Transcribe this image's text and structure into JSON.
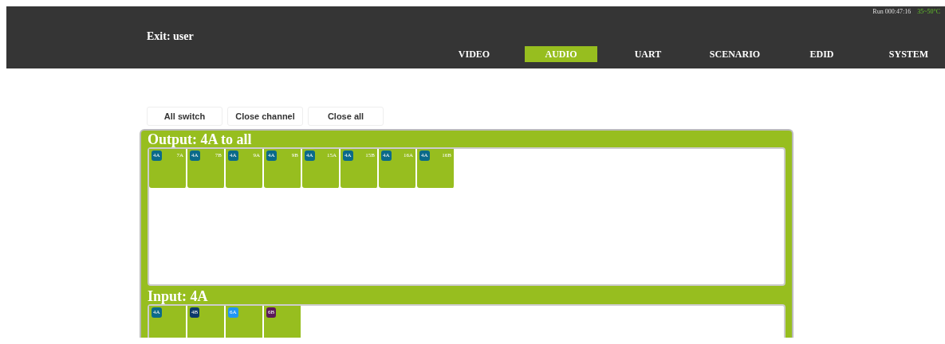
{
  "status": {
    "run": "Run 000:47:16",
    "temperature": "35~50°C"
  },
  "user": "Exit: user",
  "tabs": [
    {
      "label": "VIDEO",
      "selected": false
    },
    {
      "label": "AUDIO",
      "selected": true
    },
    {
      "label": "UART",
      "selected": false
    },
    {
      "label": "SCENARIO",
      "selected": false
    },
    {
      "label": "EDID",
      "selected": false
    },
    {
      "label": "SYSTEM",
      "selected": false
    }
  ],
  "buttons": [
    "All switch",
    "Close channel",
    "Close all"
  ],
  "output": {
    "title": "Output: 4A to all",
    "tiles": [
      {
        "badge": "4A",
        "color": "#0b6a8a",
        "label": "7A"
      },
      {
        "badge": "4A",
        "color": "#0b6a8a",
        "label": "7B"
      },
      {
        "badge": "4A",
        "color": "#0b6a8a",
        "label": "9A"
      },
      {
        "badge": "4A",
        "color": "#0b6a8a",
        "label": "9B"
      },
      {
        "badge": "4A",
        "color": "#0b6a8a",
        "label": "15A"
      },
      {
        "badge": "4A",
        "color": "#0b6a8a",
        "label": "15B"
      },
      {
        "badge": "4A",
        "color": "#0b6a8a",
        "label": "16A"
      },
      {
        "badge": "4A",
        "color": "#0b6a8a",
        "label": "16B"
      }
    ]
  },
  "input": {
    "title": "Input: 4A",
    "tiles": [
      {
        "badge": "4A",
        "color": "#0b6a8a"
      },
      {
        "badge": "4B",
        "color": "#0d3a6a"
      },
      {
        "badge": "6A",
        "color": "#2196f3"
      },
      {
        "badge": "6B",
        "color": "#5c1a5a"
      }
    ]
  }
}
